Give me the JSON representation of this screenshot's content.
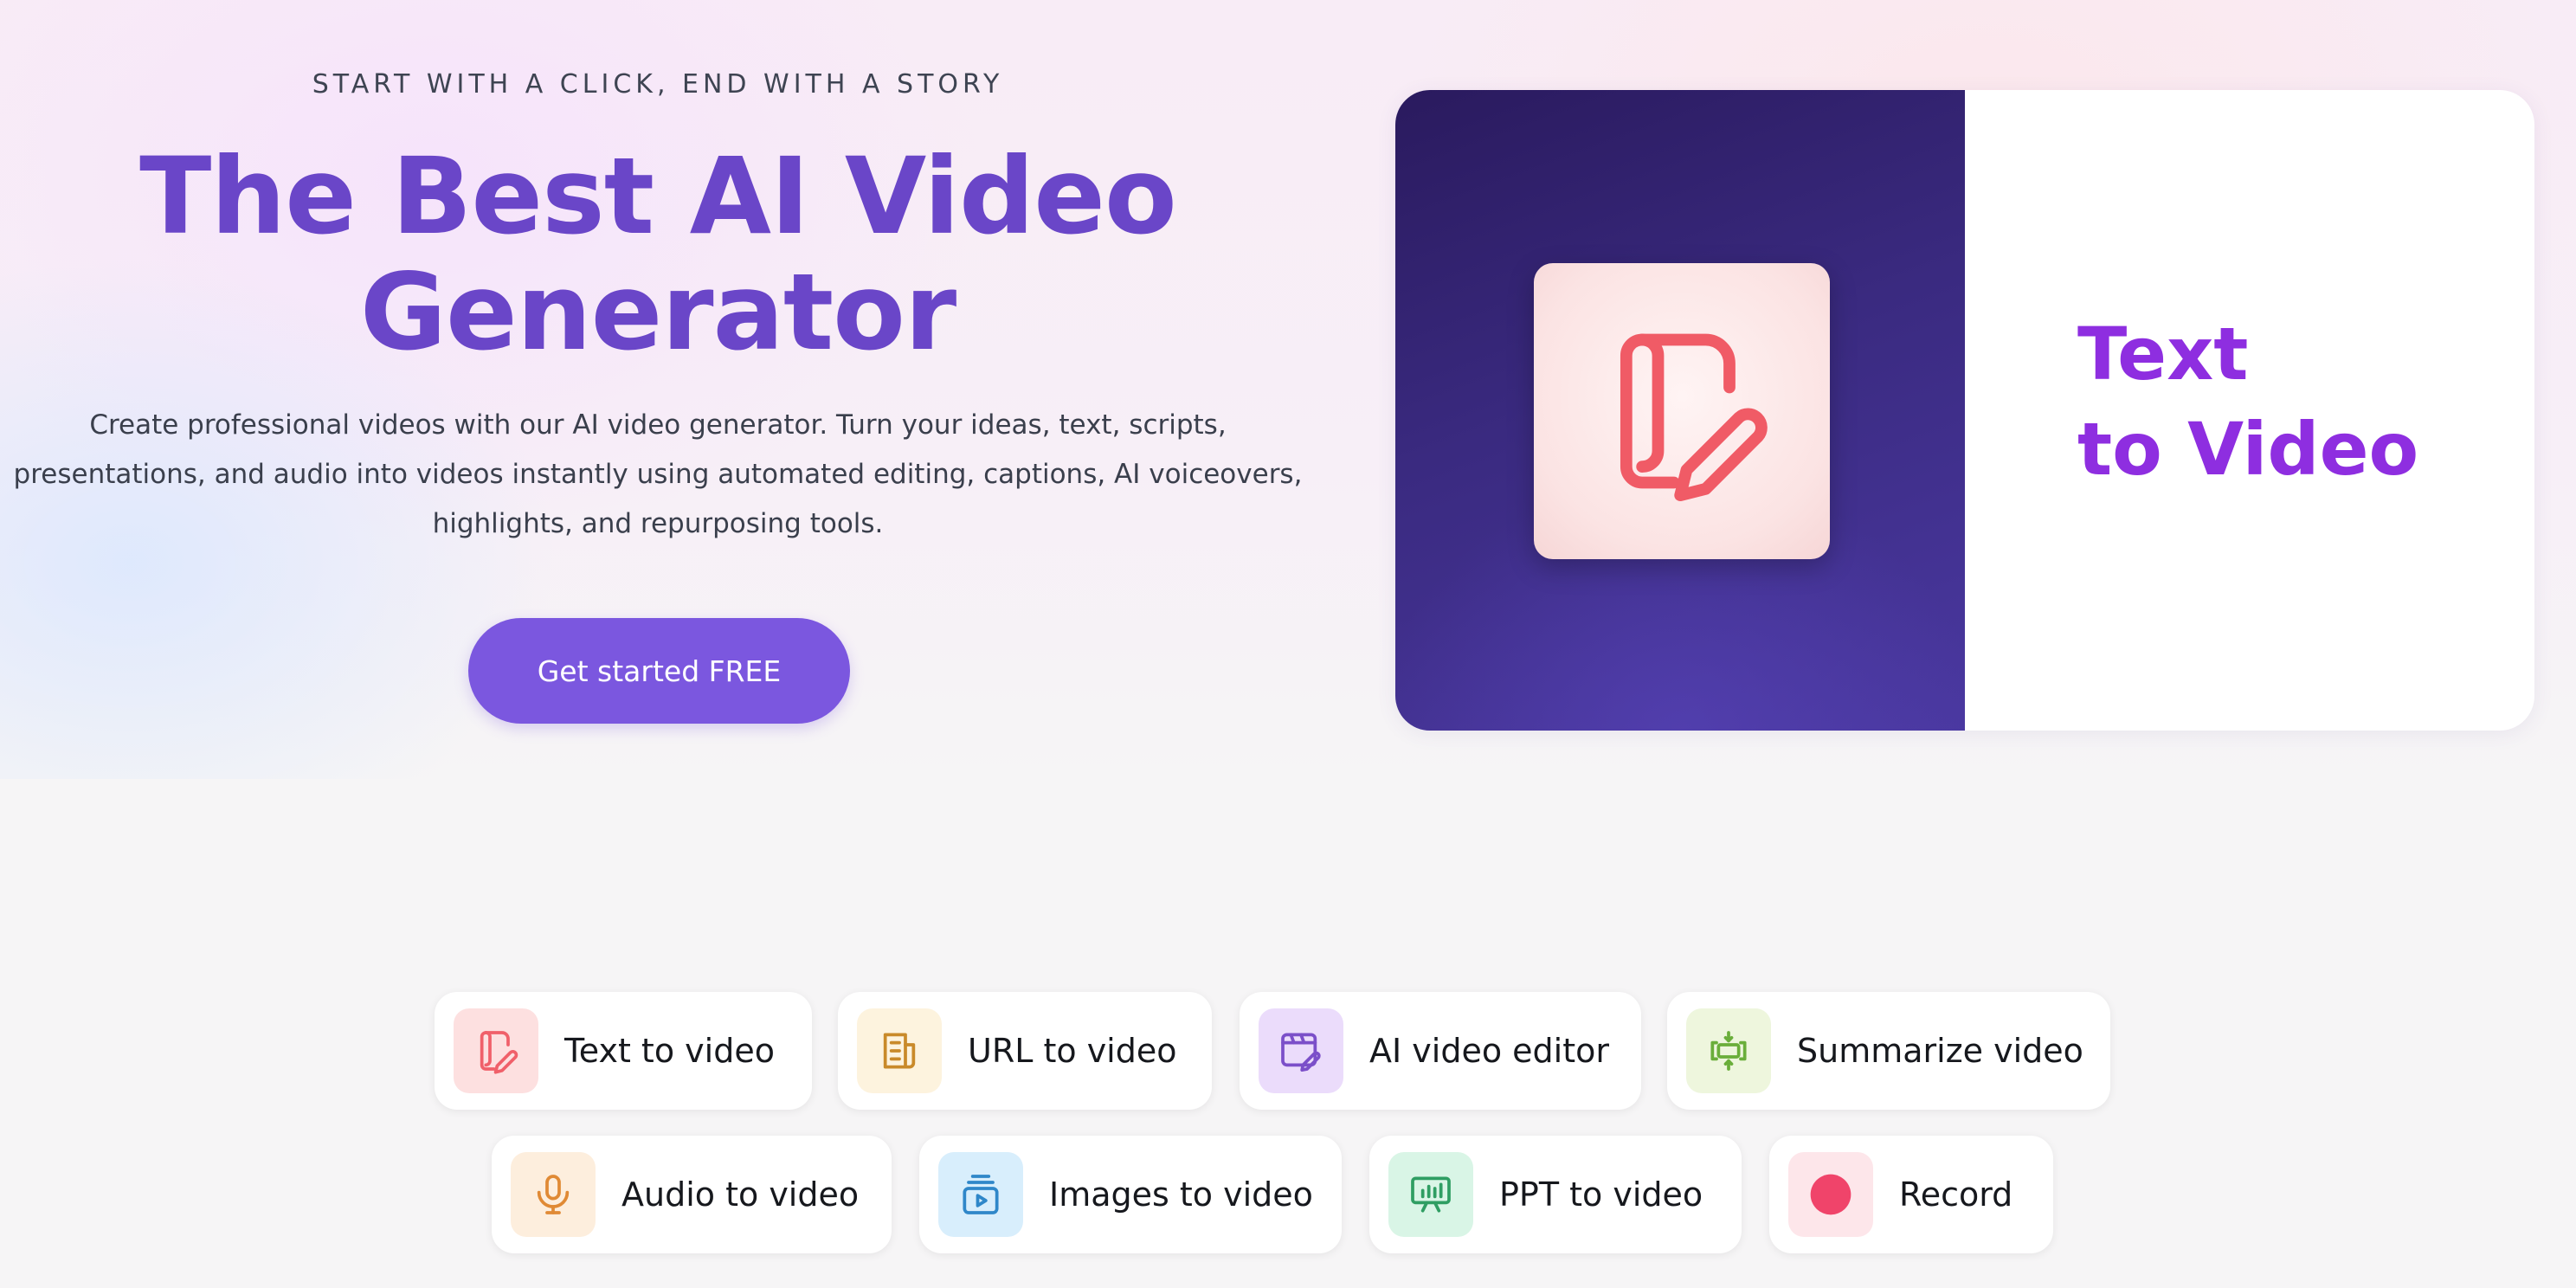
{
  "hero": {
    "eyebrow": "START WITH A CLICK, END WITH A STORY",
    "title_line1": "The Best AI Video",
    "title_line2": "Generator",
    "subtitle_lines": [
      "Create professional videos with our AI video generator. Turn your ideas, text, scripts,",
      "presentations, and audio into videos instantly using automated editing, captions, AI voiceovers,",
      "highlights, and repurposing tools."
    ],
    "cta_label": "Get started FREE"
  },
  "feature_card": {
    "title_line1": "Text",
    "title_line2": "to Video",
    "icon": "scroll-pencil-icon",
    "accent": "#8e2ee0"
  },
  "tools": [
    {
      "label": "Text to video",
      "icon": "scroll-pencil-icon",
      "bg": "#fde0e0",
      "color": "#f0606a"
    },
    {
      "label": "URL to video",
      "icon": "document-icon",
      "bg": "#fdf3de",
      "color": "#c98a2a"
    },
    {
      "label": "AI video editor",
      "icon": "video-edit-icon",
      "bg": "#ebdcfb",
      "color": "#7b4fc9"
    },
    {
      "label": "Summarize video",
      "icon": "summarize-icon",
      "bg": "#eef6dd",
      "color": "#6aae3a"
    },
    {
      "label": "Audio to video",
      "icon": "microphone-icon",
      "bg": "#fdeedd",
      "color": "#e08a35"
    },
    {
      "label": "Images to video",
      "icon": "images-icon",
      "bg": "#d8eefc",
      "color": "#2f87c9"
    },
    {
      "label": "PPT to video",
      "icon": "presentation-icon",
      "bg": "#d9f5e6",
      "color": "#2f9e63"
    },
    {
      "label": "Record",
      "icon": "record-icon",
      "bg": "#fde6ea",
      "color": "#f0446a"
    }
  ]
}
